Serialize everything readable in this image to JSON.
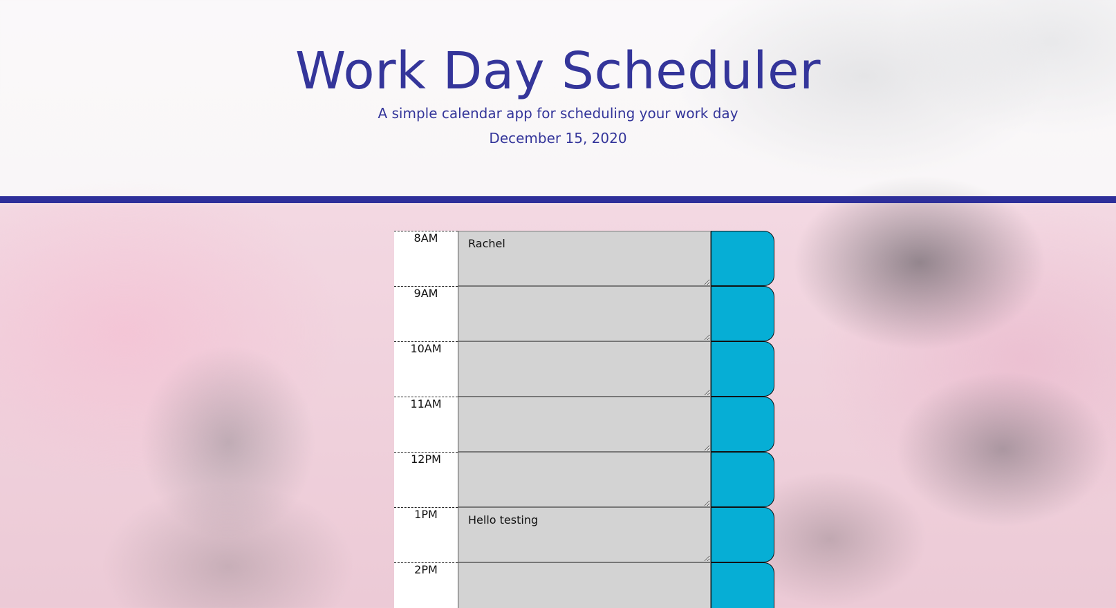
{
  "header": {
    "title": "Work Day Scheduler",
    "subtitle": "A simple calendar app for scheduling your work day",
    "current_date": "December 15, 2020"
  },
  "colors": {
    "accent": "#34359a",
    "save_button": "#06aed5",
    "textarea": "#d3d3d3"
  },
  "timeblocks": [
    {
      "hour": "8AM",
      "text": "Rachel"
    },
    {
      "hour": "9AM",
      "text": ""
    },
    {
      "hour": "10AM",
      "text": ""
    },
    {
      "hour": "11AM",
      "text": ""
    },
    {
      "hour": "12PM",
      "text": ""
    },
    {
      "hour": "1PM",
      "text": "Hello testing"
    },
    {
      "hour": "2PM",
      "text": ""
    }
  ]
}
